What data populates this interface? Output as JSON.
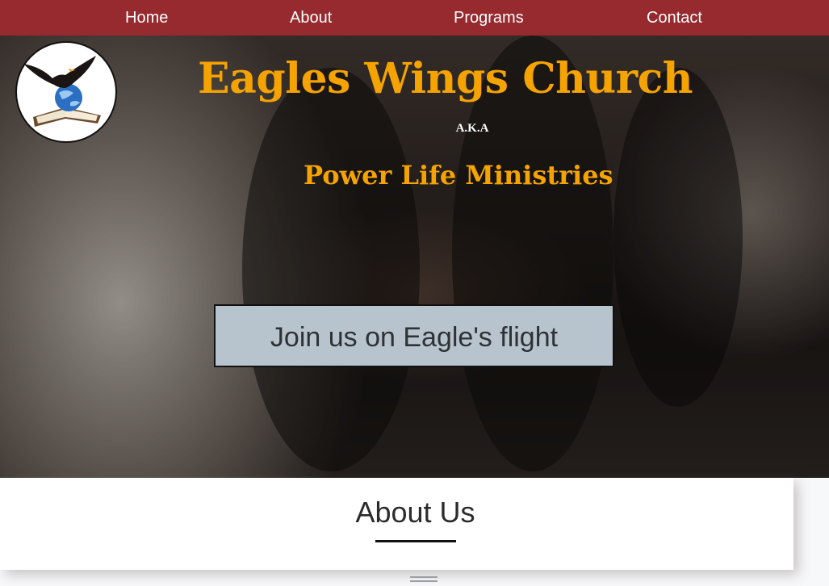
{
  "nav": {
    "items": [
      {
        "label": "Home"
      },
      {
        "label": "About"
      },
      {
        "label": "Programs"
      },
      {
        "label": "Contact"
      }
    ]
  },
  "hero": {
    "title": "Eagles Wings Church",
    "aka": "A.K.A",
    "subtitle": "Power Life Ministries",
    "cta_label": "Join us on Eagle's flight"
  },
  "about": {
    "title": "About Us"
  },
  "colors": {
    "navbar": "#962a2e",
    "title_gold": "#f5a300",
    "cta_bg": "#b8c4cd"
  },
  "icons": {
    "logo": "eagle-bible-globe-logo",
    "handle": "drag-handle-icon"
  }
}
